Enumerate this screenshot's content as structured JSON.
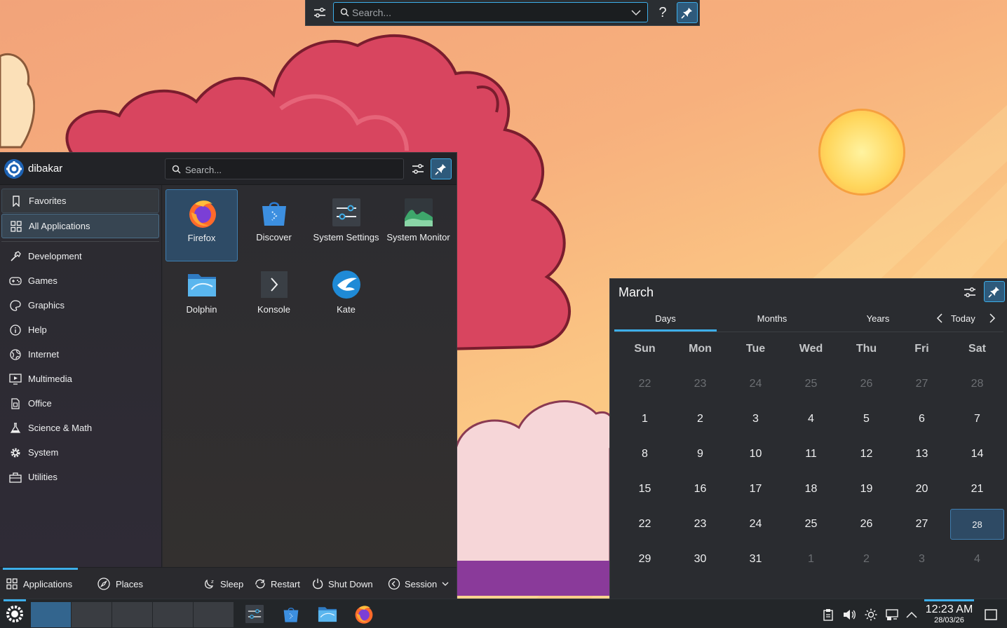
{
  "colors": {
    "accent": "#3daee9",
    "panel": "#232629",
    "selection": "#2e4b66"
  },
  "krunner": {
    "search_placeholder": "Search...",
    "help_label": "?",
    "icons": {
      "config": "configure-icon",
      "search": "search-icon",
      "history": "chevron-down-icon",
      "pin": "pin-icon"
    }
  },
  "launcher": {
    "username": "dibakar",
    "search_placeholder": "Search...",
    "sidebar": [
      {
        "label": "Favorites",
        "icon": "bookmark-icon",
        "state": "hovered"
      },
      {
        "label": "All Applications",
        "icon": "grid-icon",
        "state": "selected"
      },
      {
        "label": "Development",
        "icon": "hammer-icon"
      },
      {
        "label": "Games",
        "icon": "gamepad-icon"
      },
      {
        "label": "Graphics",
        "icon": "palette-icon"
      },
      {
        "label": "Help",
        "icon": "info-icon"
      },
      {
        "label": "Internet",
        "icon": "globe-icon"
      },
      {
        "label": "Multimedia",
        "icon": "monitor-play-icon"
      },
      {
        "label": "Office",
        "icon": "document-icon"
      },
      {
        "label": "Science & Math",
        "icon": "flask-icon"
      },
      {
        "label": "System",
        "icon": "gear-icon"
      },
      {
        "label": "Utilities",
        "icon": "toolbox-icon"
      }
    ],
    "apps": [
      {
        "name": "Firefox",
        "icon": "firefox-icon",
        "selected": true
      },
      {
        "name": "Discover",
        "icon": "discover-icon"
      },
      {
        "name": "System Settings",
        "icon": "system-settings-icon"
      },
      {
        "name": "System Monitor",
        "icon": "system-monitor-icon"
      },
      {
        "name": "Dolphin",
        "icon": "dolphin-folder-icon"
      },
      {
        "name": "Konsole",
        "icon": "konsole-icon"
      },
      {
        "name": "Kate",
        "icon": "kate-icon"
      }
    ],
    "footer": {
      "tabs": [
        {
          "label": "Applications",
          "icon": "grid-icon",
          "active": true
        },
        {
          "label": "Places",
          "icon": "compass-icon"
        }
      ],
      "actions": [
        {
          "label": "Sleep",
          "icon": "sleep-icon"
        },
        {
          "label": "Restart",
          "icon": "restart-icon"
        },
        {
          "label": "Shut Down",
          "icon": "power-icon"
        },
        {
          "label": "Session",
          "icon": "session-icon"
        }
      ]
    }
  },
  "calendar": {
    "month": "March",
    "tabs": [
      {
        "label": "Days",
        "active": true
      },
      {
        "label": "Months"
      },
      {
        "label": "Years"
      }
    ],
    "today_label": "Today",
    "weekdays": [
      "Sun",
      "Mon",
      "Tue",
      "Wed",
      "Thu",
      "Fri",
      "Sat"
    ],
    "weeks": [
      [
        "22",
        "23",
        "24",
        "25",
        "26",
        "27",
        "28"
      ],
      [
        "1",
        "2",
        "3",
        "4",
        "5",
        "6",
        "7"
      ],
      [
        "8",
        "9",
        "10",
        "11",
        "12",
        "13",
        "14"
      ],
      [
        "15",
        "16",
        "17",
        "18",
        "19",
        "20",
        "21"
      ],
      [
        "22",
        "23",
        "24",
        "25",
        "26",
        "27",
        "28"
      ],
      [
        "29",
        "30",
        "31",
        "1",
        "2",
        "3",
        "4"
      ]
    ],
    "other_month": [
      [
        true,
        true,
        true,
        true,
        true,
        true,
        true
      ],
      [
        false,
        false,
        false,
        false,
        false,
        false,
        false
      ],
      [
        false,
        false,
        false,
        false,
        false,
        false,
        false
      ],
      [
        false,
        false,
        false,
        false,
        false,
        false,
        false
      ],
      [
        false,
        false,
        false,
        false,
        false,
        false,
        false
      ],
      [
        false,
        false,
        false,
        true,
        true,
        true,
        true
      ]
    ],
    "selected_day": "28"
  },
  "panel": {
    "virtual_desktops": 5,
    "current_desktop": 1,
    "tasks": [
      {
        "icon": "system-settings-icon",
        "name": "System Settings"
      },
      {
        "icon": "discover-icon",
        "name": "Discover"
      },
      {
        "icon": "dolphin-folder-icon",
        "name": "Dolphin"
      },
      {
        "icon": "firefox-icon",
        "name": "Firefox"
      }
    ],
    "tray": [
      "clipboard-icon",
      "volume-icon",
      "brightness-icon",
      "network-icon",
      "chevron-up-icon"
    ],
    "clock": {
      "time": "12:23 AM",
      "date": "28/03/26"
    }
  }
}
